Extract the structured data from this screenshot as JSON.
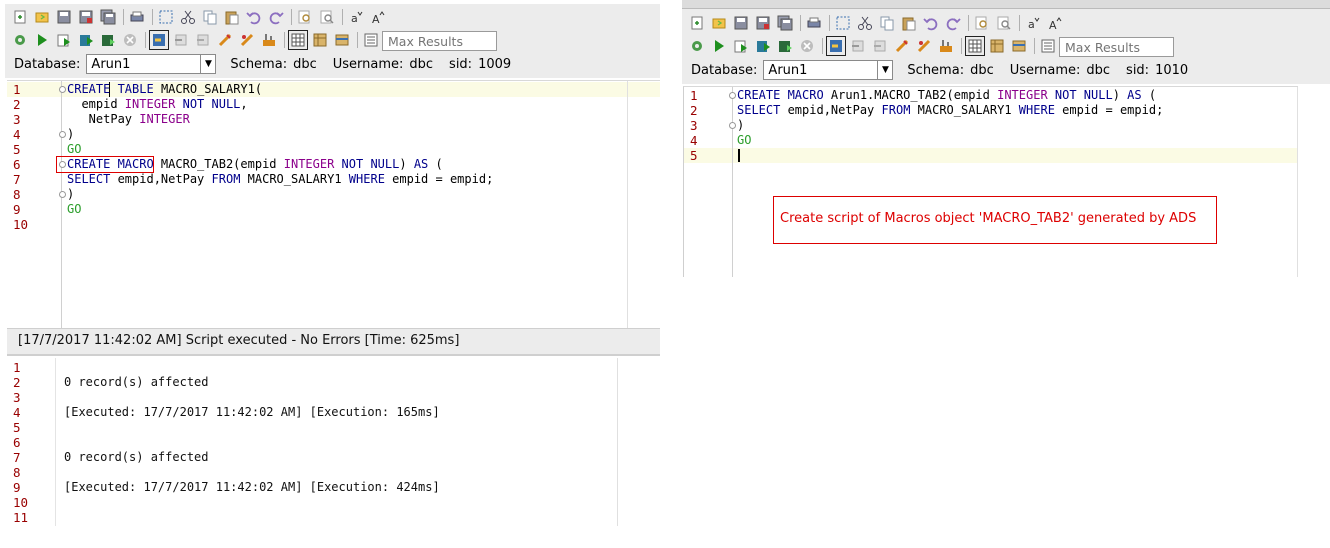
{
  "left": {
    "max_results_placeholder": "Max Results",
    "database_label": "Database:",
    "database_value": "Arun1",
    "schema_label": "Schema:",
    "schema_value": "dbc",
    "username_label": "Username:",
    "username_value": "dbc",
    "sid_label": "sid:",
    "sid_value": "1009",
    "line_numbers": [
      "1",
      "2",
      "3",
      "4",
      "5",
      "6",
      "7",
      "8",
      "9",
      "10"
    ],
    "code": {
      "l1_a": "CREATE",
      "l1_b": " TABLE",
      "l1_c": " MACRO_SALARY1(",
      "l2_a": "  empid ",
      "l2_b": "INTEGER",
      "l2_c": " NOT NULL",
      "l2_d": ",",
      "l3_a": "   NetPay ",
      "l3_b": "INTEGER",
      "l4": ")",
      "l5": "GO",
      "l6_a": "CREATE MACRO",
      "l6_b": " MACRO_TAB2(empid ",
      "l6_c": "INTEGER",
      "l6_d": " NOT NULL",
      "l6_e": ") ",
      "l6_f": "AS",
      "l6_g": " (",
      "l7_a": "SELECT",
      "l7_b": " empid,NetPay ",
      "l7_c": "FROM",
      "l7_d": " MACRO_SALARY1 ",
      "l7_e": "WHERE",
      "l7_f": " empid = empid;",
      "l8": ")",
      "l9": "GO"
    },
    "status": "[17/7/2017 11:42:02 AM] Script executed - No Errors [Time: 625ms]",
    "output_line_numbers": [
      "1",
      "2",
      "3",
      "4",
      "5",
      "6",
      "7",
      "8",
      "9",
      "10",
      "11"
    ],
    "output": {
      "o2": "0 record(s) affected",
      "o4": "[Executed: 17/7/2017 11:42:02 AM] [Execution: 165ms]",
      "o7": "0 record(s) affected",
      "o9": "[Executed: 17/7/2017 11:42:02 AM] [Execution: 424ms]"
    }
  },
  "right": {
    "max_results_placeholder": "Max Results",
    "database_label": "Database:",
    "database_value": "Arun1",
    "schema_label": "Schema:",
    "schema_value": "dbc",
    "username_label": "Username:",
    "username_value": "dbc",
    "sid_label": "sid:",
    "sid_value": "1010",
    "line_numbers": [
      "1",
      "2",
      "3",
      "4",
      "5"
    ],
    "code": {
      "l1_a": "CREATE MACRO",
      "l1_b": " Arun1.MACRO_TAB2(empid ",
      "l1_c": "INTEGER",
      "l1_d": " NOT NULL",
      "l1_e": ") ",
      "l1_f": "AS",
      "l1_g": " (",
      "l2_a": "SELECT",
      "l2_b": " empid,NetPay ",
      "l2_c": "FROM",
      "l2_d": " MACRO_SALARY1 ",
      "l2_e": "WHERE",
      "l2_f": " empid = empid;",
      "l3": ")",
      "l4": "GO"
    },
    "annotation": "Create script of Macros object 'MACRO_TAB2' generated by ADS"
  },
  "colors": {
    "keyword": "#00008b",
    "type_keyword": "#8b008b",
    "go": "#2a9d2a",
    "line_number": "#990000",
    "annotation": "#dd0000",
    "toolbar_bg": "#ececec"
  },
  "toolbar_icons_row1": [
    "new-file-icon",
    "open-file-icon",
    "save-icon",
    "save-as-icon",
    "save-all-icon",
    "print-icon",
    "select-all-icon",
    "cut-icon",
    "copy-icon",
    "paste-icon",
    "undo-icon",
    "redo-icon",
    "find-icon",
    "find-replace-icon",
    "lowercase-icon",
    "uppercase-icon"
  ],
  "toolbar_icons_row2": [
    "settings-icon",
    "run-icon",
    "run-selection-icon",
    "run-script-icon",
    "export-icon",
    "stop-icon",
    "auto-commit-icon",
    "commit-icon",
    "rollback-icon",
    "disconnect-icon",
    "explain-icon",
    "format-icon",
    "grid-view-icon",
    "text-view-icon",
    "history-icon",
    "max-results-icon"
  ]
}
